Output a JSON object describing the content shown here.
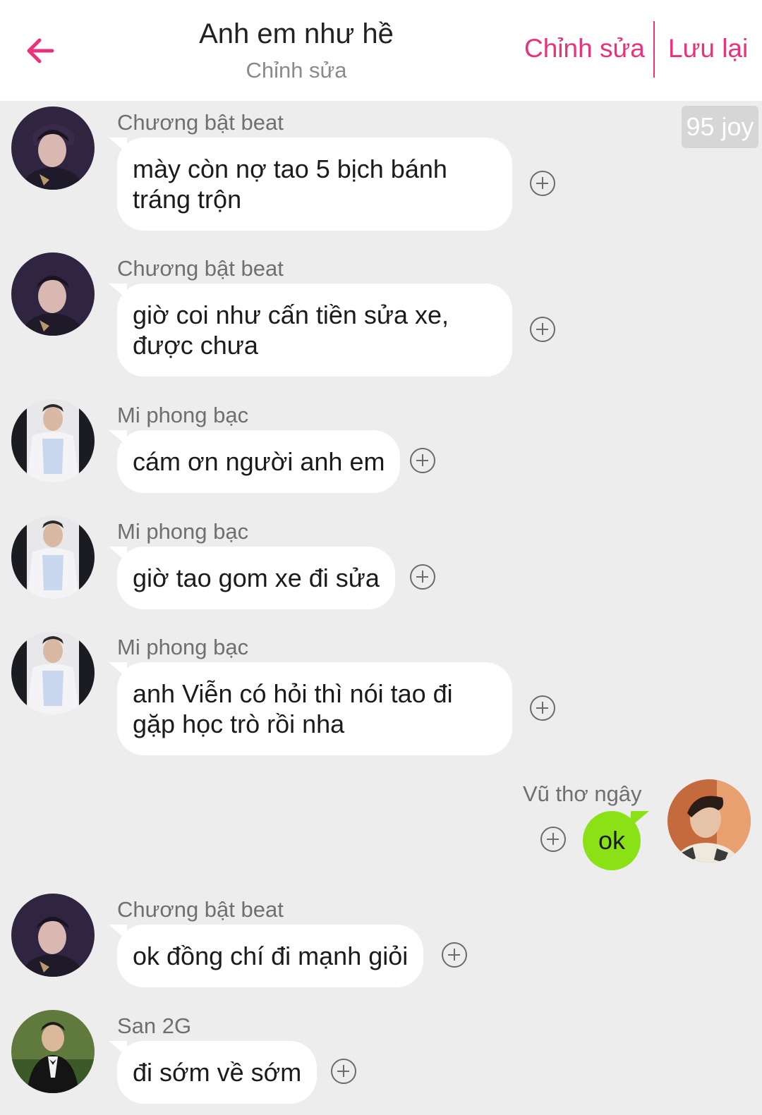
{
  "header": {
    "title": "Anh em như hề",
    "subtitle": "Chỉnh sửa",
    "edit_label": "Chỉnh sửa",
    "save_label": "Lưu lại",
    "accent_color": "#e8327c"
  },
  "joy_badge": "95 joy",
  "messages": [
    {
      "sender": "Chương bật beat",
      "text": "mày còn nợ tao 5 bịch bánh tráng trộn",
      "side": "left"
    },
    {
      "sender": "Chương bật beat",
      "text": "giờ coi như cấn tiền sửa xe, được chưa",
      "side": "left"
    },
    {
      "sender": "Mi phong bạc",
      "text": "cám ơn người anh em",
      "side": "left"
    },
    {
      "sender": "Mi phong bạc",
      "text": "giờ tao gom xe đi sửa",
      "side": "left"
    },
    {
      "sender": "Mi phong bạc",
      "text": "anh Viễn có hỏi thì nói tao đi gặp học trò rồi nha",
      "side": "left"
    },
    {
      "sender": "Vũ thơ ngây",
      "text": "ok",
      "side": "right",
      "bubble_color": "#8ae115"
    },
    {
      "sender": "Chương bật beat",
      "text": "ok đồng chí đi mạnh giỏi",
      "side": "left"
    },
    {
      "sender": "San 2G",
      "text": "đi sớm về sớm",
      "side": "left"
    }
  ],
  "icons": {
    "back": "arrow-left-icon",
    "add_reaction": "plus-circle-icon"
  }
}
